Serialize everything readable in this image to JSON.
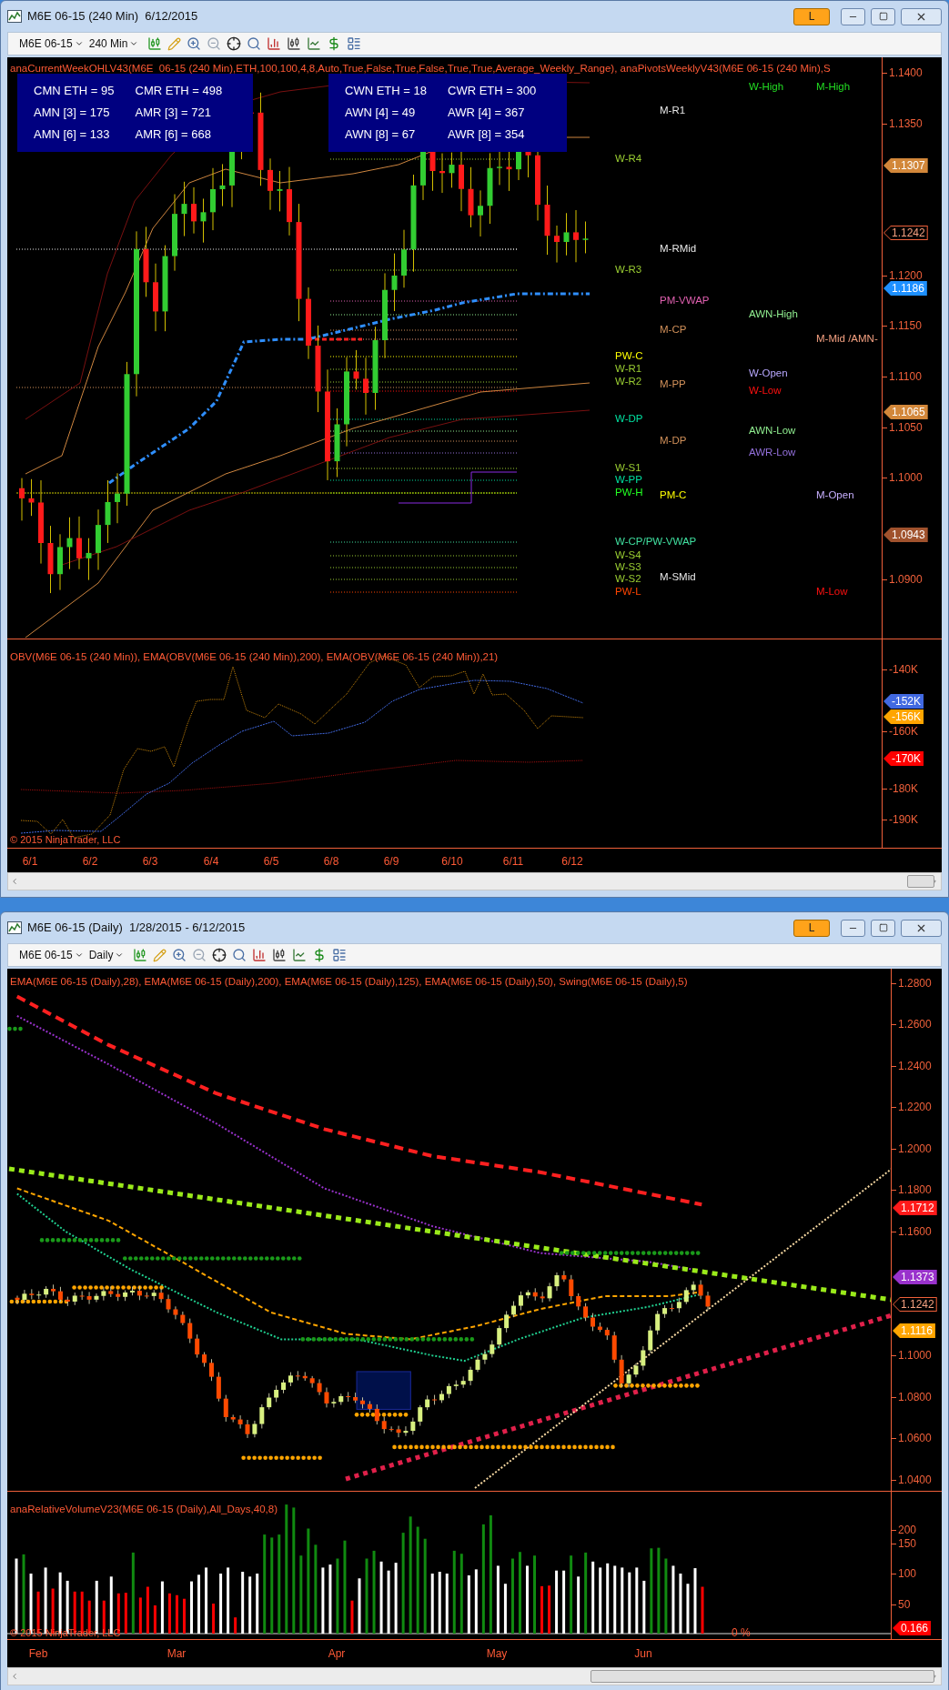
{
  "top_window": {
    "title": "M6E 06-15 (240 Min)  6/12/2015",
    "badge": "L",
    "instrument": "M6E 06-15",
    "interval": "240 Min",
    "price_panel": {
      "indicator_text": "anaCurrentWeekOHLV43(M6E  06-15 (240 Min),ETH,100,100,4,8,Auto,True,False,True,False,True,True,Average_Weekly_Range), anaPivotsWeeklyV43(M6E 06-15 (240 Min),S",
      "stats_boxes": [
        {
          "items": [
            "CMN ETH = 95",
            "CMR ETH = 498",
            "AMN [3] = 175",
            "AMR [3] = 721",
            "AMN [6] = 133",
            "AMR [6] = 668"
          ]
        },
        {
          "items": [
            "CWN ETH = 18",
            "CWR ETH = 300",
            "AWN [4] = 49",
            "AWR [4] = 367",
            "AWN [8] = 67",
            "AWR [8] = 354"
          ]
        }
      ],
      "pivot_labels": [
        {
          "text": "W-High",
          "color": "#22dd22"
        },
        {
          "text": "M-High",
          "color": "#22dd22"
        },
        {
          "text": "M-R1",
          "color": "#e8e8e8"
        },
        {
          "text": "W-R4",
          "color": "#9acd32"
        },
        {
          "text": "M-RMid",
          "color": "#e8e8e8"
        },
        {
          "text": "W-R3",
          "color": "#9acd32"
        },
        {
          "text": "PM-VWAP",
          "color": "#e060b0"
        },
        {
          "text": "AWN-High",
          "color": "#90ee90"
        },
        {
          "text": "M-CP",
          "color": "#d2915a"
        },
        {
          "text": "M-Mid /AMN-",
          "color": "#f4a080"
        },
        {
          "text": "PW-C",
          "color": "#ffff00"
        },
        {
          "text": "W-R1",
          "color": "#9acd32"
        },
        {
          "text": "W-R2",
          "color": "#9acd32"
        },
        {
          "text": "M-PP",
          "color": "#d2915a"
        },
        {
          "text": "W-Open",
          "color": "#b8a8ff"
        },
        {
          "text": "W-Low",
          "color": "#ff1010"
        },
        {
          "text": "W-DP",
          "color": "#00e0a0"
        },
        {
          "text": "AWN-Low",
          "color": "#90ee90"
        },
        {
          "text": "M-DP",
          "color": "#d2915a"
        },
        {
          "text": "AWR-Low",
          "color": "#9370db"
        },
        {
          "text": "W-S1",
          "color": "#9acd32"
        },
        {
          "text": "W-PP",
          "color": "#00e0a0"
        },
        {
          "text": "PW-H",
          "color": "#22ff22"
        },
        {
          "text": "PM-C",
          "color": "#ffff00"
        },
        {
          "text": "M-Open",
          "color": "#c8b0ff"
        },
        {
          "text": "W-CP/PW-VWAP",
          "color": "#40e0a0"
        },
        {
          "text": "W-S4",
          "color": "#9acd32"
        },
        {
          "text": "W-S3",
          "color": "#9acd32"
        },
        {
          "text": "W-S2",
          "color": "#9acd32"
        },
        {
          "text": "M-SMid",
          "color": "#e8e8e8"
        },
        {
          "text": "PW-L",
          "color": "#ff4500"
        },
        {
          "text": "M-Low",
          "color": "#ff1010"
        }
      ],
      "axis_ticks": [
        "1.1400",
        "1.1350",
        "1.1200",
        "1.1150",
        "1.1100",
        "1.1050",
        "1.1000",
        "1.0900"
      ],
      "price_markers": [
        {
          "text": "1.1307",
          "color": "#d2873a",
          "kind": "filled"
        },
        {
          "text": "1.1242",
          "color": "#f0603a",
          "kind": "outline"
        },
        {
          "text": "1.1186",
          "color": "#1e90ff",
          "kind": "filled"
        },
        {
          "text": "1.1065",
          "color": "#d2873a",
          "kind": "filled"
        },
        {
          "text": "1.0943",
          "color": "#a0522d",
          "kind": "filled"
        }
      ]
    },
    "obv_panel": {
      "indicator_text": "OBV(M6E 06-15 (240 Min)), EMA(OBV(M6E 06-15 (240 Min)),200), EMA(OBV(M6E 06-15 (240 Min)),21)",
      "copyright": "© 2015 NinjaTrader, LLC",
      "axis_ticks": [
        "-140K",
        "-160K",
        "-180K",
        "-190K"
      ],
      "price_markers": [
        {
          "text": "-152K",
          "color": "#4169e1",
          "kind": "filled"
        },
        {
          "text": "-156K",
          "color": "#ffa500",
          "kind": "filled"
        },
        {
          "text": "-170K",
          "color": "#ff0000",
          "kind": "filled"
        }
      ]
    },
    "x_labels": [
      "6/1",
      "6/2",
      "6/3",
      "6/4",
      "6/5",
      "6/8",
      "6/9",
      "6/10",
      "6/11",
      "6/12"
    ]
  },
  "bottom_window": {
    "title": "M6E 06-15 (Daily)  1/28/2015 - 6/12/2015",
    "badge": "L",
    "instrument": "M6E 06-15",
    "interval": "Daily",
    "price_panel": {
      "indicator_text": "EMA(M6E 06-15 (Daily),28), EMA(M6E 06-15 (Daily),200), EMA(M6E 06-15 (Daily),125), EMA(M6E 06-15 (Daily),50), Swing(M6E 06-15 (Daily),5)",
      "axis_ticks": [
        "1.2800",
        "1.2600",
        "1.2400",
        "1.2200",
        "1.2000",
        "1.1800",
        "1.1600",
        "1.1000",
        "1.0800",
        "1.0600",
        "1.0400"
      ],
      "price_markers": [
        {
          "text": "1.1712",
          "color": "#ff1a1a",
          "kind": "filled"
        },
        {
          "text": "1.1373",
          "color": "#9932cc",
          "kind": "filled"
        },
        {
          "text": "1.1242",
          "color": "#f0603a",
          "kind": "outline"
        },
        {
          "text": "1.1116",
          "color": "#ffa500",
          "kind": "filled"
        }
      ]
    },
    "volume_panel": {
      "indicator_text": "anaRelativeVolumeV23(M6E 06-15 (Daily),All_Days,40,8)",
      "copyright": "© 2015 NinjaTrader, LLC",
      "percent_label": "0 %",
      "axis_ticks": [
        "200",
        "150",
        "100",
        "50"
      ],
      "price_markers": [
        {
          "text": "0.166",
          "color": "#ff0000",
          "kind": "filled"
        }
      ]
    },
    "x_labels": [
      "Feb",
      "Mar",
      "Apr",
      "May",
      "Jun"
    ]
  }
}
